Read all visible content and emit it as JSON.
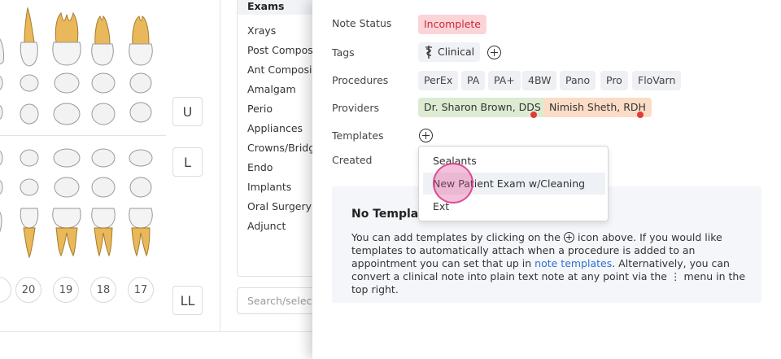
{
  "tooth_chart": {
    "quadrant_buttons": {
      "upper": "U",
      "lower": "L",
      "lower_left": "LL"
    },
    "tooth_numbers": [
      "20",
      "19",
      "18",
      "17"
    ]
  },
  "procedure_categories": {
    "items": [
      "Exams",
      "Xrays",
      "Post Composit",
      "Ant Composite",
      "Amalgam",
      "Perio",
      "Appliances",
      "Crowns/Bridge",
      "Endo",
      "Implants",
      "Oral Surgery",
      "Adjunct"
    ],
    "active": "Exams",
    "search_placeholder": "Search/select p"
  },
  "note": {
    "status": {
      "label": "Note Status",
      "value": "Incomplete"
    },
    "tags": {
      "label": "Tags",
      "items": [
        "Clinical"
      ]
    },
    "procedures": {
      "label": "Procedures",
      "items": [
        "PerEx",
        "PA",
        "PA+",
        "4BW",
        "Pano",
        "Pro",
        "FloVarn"
      ]
    },
    "providers": {
      "label": "Providers",
      "items": [
        "Dr. Sharon Brown, DDS",
        "Nimish Sheth, RDH"
      ]
    },
    "templates": {
      "label": "Templates"
    },
    "created": {
      "label": "Created"
    }
  },
  "templates_dropdown": {
    "options": [
      "Sealants",
      "New Patient Exam w/Cleaning",
      "Ext"
    ],
    "highlighted": "New Patient Exam w/Cleaning"
  },
  "info": {
    "title": "No Templates",
    "text_1": "You can add templates by clicking on the",
    "text_2": "icon above. If you would like templates to automatically attach when a procedure is added to an appointment you can set that up in",
    "link": "note templates",
    "text_3": ". Alternatively, you can convert a clinical note into plain text note at any point via the",
    "menu_glyph": "⋮",
    "text_4": "menu in the top right."
  },
  "colors": {
    "status_bg": "#fbd4d7",
    "status_text": "#c9283b",
    "provider_1_bg": "#dcebd1",
    "provider_2_bg": "#fbdcc6",
    "link": "#2f6fd6",
    "cursor": "#e24e96"
  }
}
